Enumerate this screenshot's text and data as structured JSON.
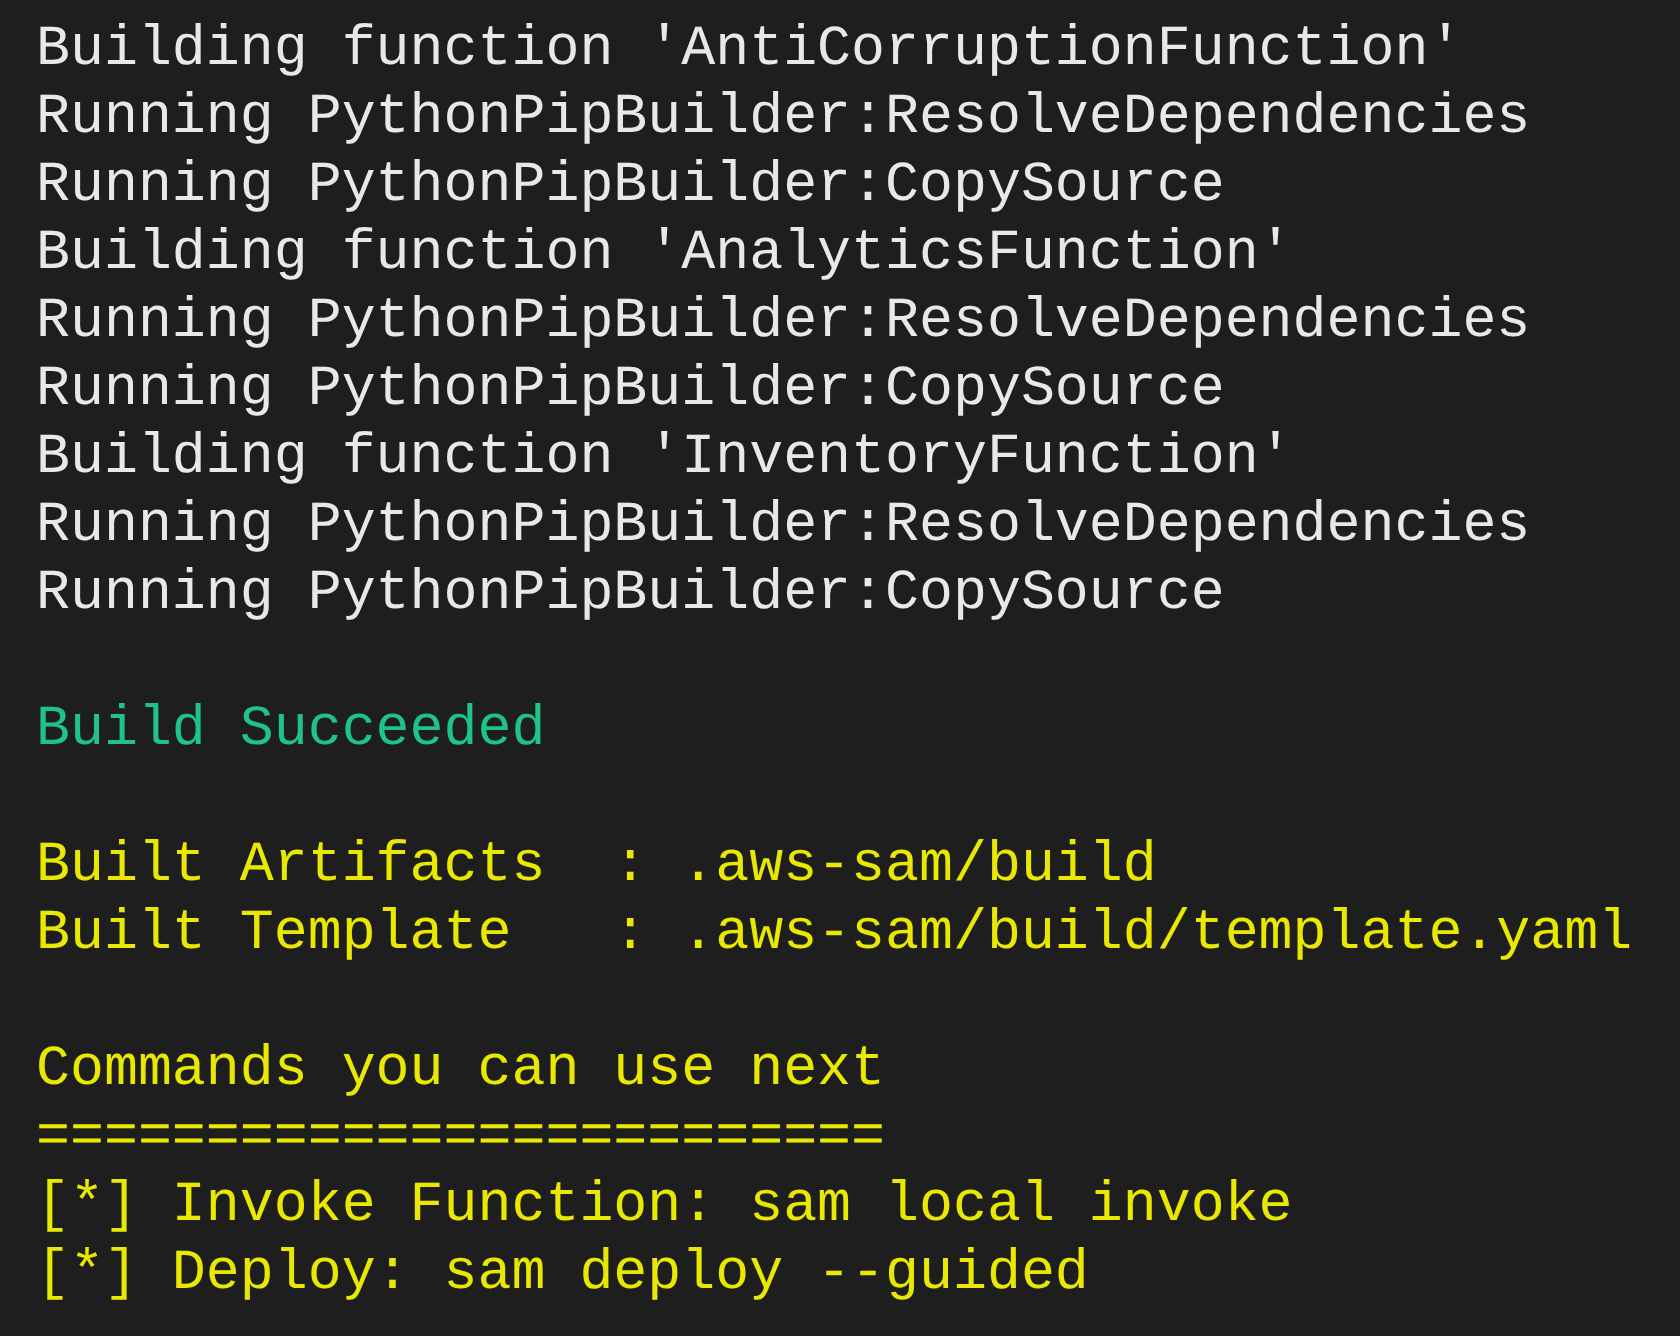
{
  "terminal": {
    "lines": [
      {
        "kind": "output",
        "text": "Building function 'AntiCorruptionFunction'"
      },
      {
        "kind": "output",
        "text": "Running PythonPipBuilder:ResolveDependencies"
      },
      {
        "kind": "output",
        "text": "Running PythonPipBuilder:CopySource"
      },
      {
        "kind": "output",
        "text": "Building function 'AnalyticsFunction'"
      },
      {
        "kind": "output",
        "text": "Running PythonPipBuilder:ResolveDependencies"
      },
      {
        "kind": "output",
        "text": "Running PythonPipBuilder:CopySource"
      },
      {
        "kind": "output",
        "text": "Building function 'InventoryFunction'"
      },
      {
        "kind": "output",
        "text": "Running PythonPipBuilder:ResolveDependencies"
      },
      {
        "kind": "output",
        "text": "Running PythonPipBuilder:CopySource"
      },
      {
        "kind": "blank"
      },
      {
        "kind": "success",
        "text": "Build Succeeded"
      },
      {
        "kind": "blank"
      },
      {
        "kind": "info",
        "text": "Built Artifacts  : .aws-sam/build"
      },
      {
        "kind": "info",
        "text": "Built Template   : .aws-sam/build/template.yaml"
      },
      {
        "kind": "blank"
      },
      {
        "kind": "info",
        "text": "Commands you can use next"
      },
      {
        "kind": "info",
        "text": "========================="
      },
      {
        "kind": "info",
        "text": "[*] Invoke Function: sam local invoke"
      },
      {
        "kind": "info",
        "text": "[*] Deploy: sam deploy --guided"
      }
    ]
  }
}
